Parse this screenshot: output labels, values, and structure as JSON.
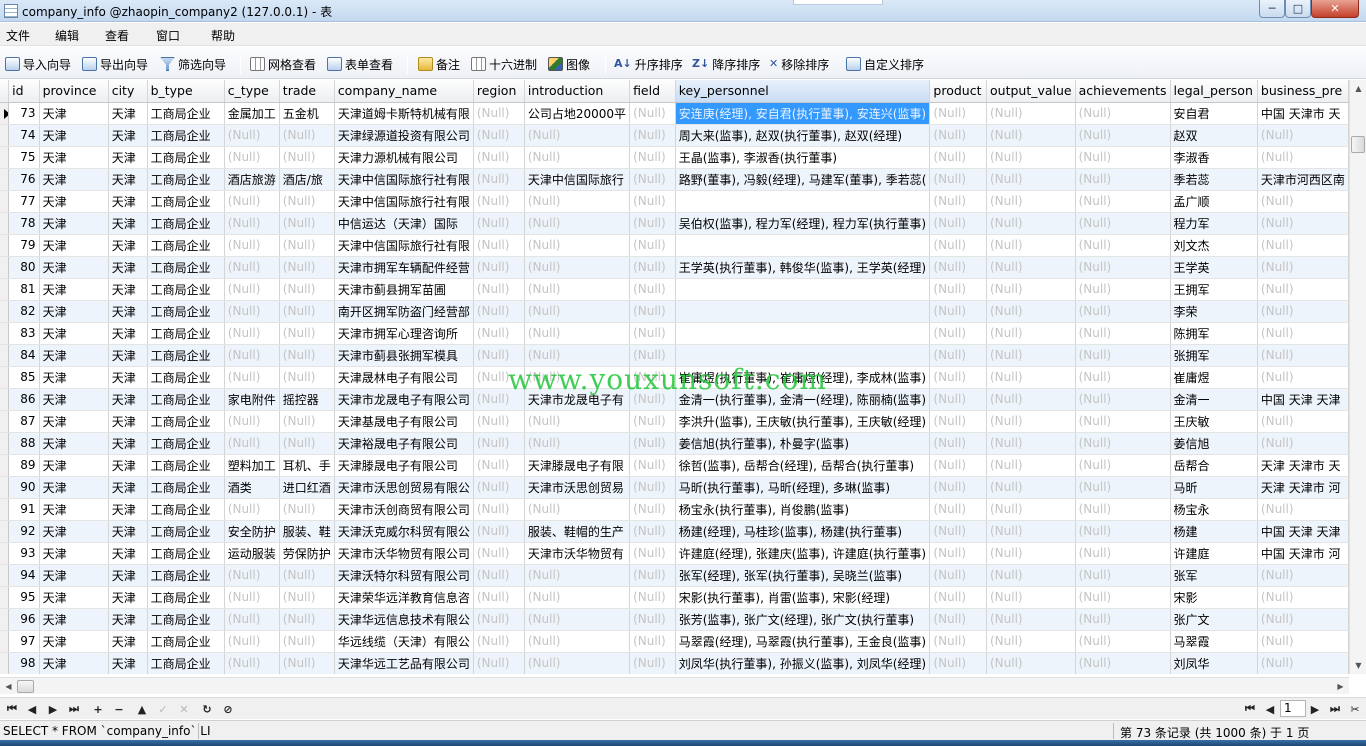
{
  "window": {
    "title": "company_info @zhaopin_company2 (127.0.0.1) - 表",
    "min": "─",
    "max": "□",
    "close": "✕"
  },
  "menu": [
    "文件",
    "编辑",
    "查看",
    "窗口",
    "帮助"
  ],
  "toolbar": {
    "import": "导入向导",
    "export": "导出向导",
    "filter": "筛选向导",
    "grid_view": "网格查看",
    "form_view": "表单查看",
    "memo": "备注",
    "hex": "十六进制",
    "image": "图像",
    "sort_asc": "升序排序",
    "sort_desc": "降序排序",
    "remove_sort": "移除排序",
    "custom_sort": "自定义排序"
  },
  "columns": [
    "id",
    "province",
    "city",
    "b_type",
    "c_type",
    "trade",
    "company_name",
    "region",
    "introduction",
    "field",
    "key_personnel",
    "product",
    "output_value",
    "achievements",
    "legal_person",
    "business_pre"
  ],
  "selected_column": "key_personnel",
  "rows": [
    [
      "73",
      "天津",
      "天津",
      "工商局企业",
      "金属加工",
      "五金机",
      "天津道姆卡斯特机械有限",
      "(Null)",
      "公司占地20000平",
      "(Null)",
      "安连庚(经理), 安自君(执行董事), 安连兴(监事)",
      "(Null)",
      "(Null)",
      "(Null)",
      "安自君",
      "中国 天津市 天"
    ],
    [
      "74",
      "天津",
      "天津",
      "工商局企业",
      "(Null)",
      "(Null)",
      "天津绿源道投资有限公司",
      "(Null)",
      "(Null)",
      "(Null)",
      "周大来(监事), 赵双(执行董事), 赵双(经理)",
      "(Null)",
      "(Null)",
      "(Null)",
      "赵双",
      "(Null)"
    ],
    [
      "75",
      "天津",
      "天津",
      "工商局企业",
      "(Null)",
      "(Null)",
      "天津力源机械有限公司",
      "(Null)",
      "(Null)",
      "(Null)",
      "王晶(监事), 李淑香(执行董事)",
      "(Null)",
      "(Null)",
      "(Null)",
      "李淑香",
      "(Null)"
    ],
    [
      "76",
      "天津",
      "天津",
      "工商局企业",
      "酒店旅游",
      "酒店/旅",
      "天津中信国际旅行社有限",
      "(Null)",
      "天津中信国际旅行",
      "(Null)",
      "路野(董事), 冯毅(经理), 马建军(董事), 季若蕊(",
      "(Null)",
      "(Null)",
      "(Null)",
      "季若蕊",
      "天津市河西区南"
    ],
    [
      "77",
      "天津",
      "天津",
      "工商局企业",
      "(Null)",
      "(Null)",
      "天津中信国际旅行社有限",
      "(Null)",
      "(Null)",
      "(Null)",
      "",
      "(Null)",
      "(Null)",
      "(Null)",
      "孟广顺",
      "(Null)"
    ],
    [
      "78",
      "天津",
      "天津",
      "工商局企业",
      "(Null)",
      "(Null)",
      "中信运达（天津）国际",
      "(Null)",
      "(Null)",
      "(Null)",
      "吴伯权(监事), 程力军(经理), 程力军(执行董事)",
      "(Null)",
      "(Null)",
      "(Null)",
      "程力军",
      "(Null)"
    ],
    [
      "79",
      "天津",
      "天津",
      "工商局企业",
      "(Null)",
      "(Null)",
      "天津中信国际旅行社有限",
      "(Null)",
      "(Null)",
      "(Null)",
      "",
      "(Null)",
      "(Null)",
      "(Null)",
      "刘文杰",
      "(Null)"
    ],
    [
      "80",
      "天津",
      "天津",
      "工商局企业",
      "(Null)",
      "(Null)",
      "天津市拥军车辆配件经营",
      "(Null)",
      "(Null)",
      "(Null)",
      "王学英(执行董事), 韩俊华(监事), 王学英(经理)",
      "(Null)",
      "(Null)",
      "(Null)",
      "王学英",
      "(Null)"
    ],
    [
      "81",
      "天津",
      "天津",
      "工商局企业",
      "(Null)",
      "(Null)",
      "天津市蓟县拥军苗圃",
      "(Null)",
      "(Null)",
      "(Null)",
      "",
      "(Null)",
      "(Null)",
      "(Null)",
      "王拥军",
      "(Null)"
    ],
    [
      "82",
      "天津",
      "天津",
      "工商局企业",
      "(Null)",
      "(Null)",
      "南开区拥军防盗门经营部",
      "(Null)",
      "(Null)",
      "(Null)",
      "",
      "(Null)",
      "(Null)",
      "(Null)",
      "李荣",
      "(Null)"
    ],
    [
      "83",
      "天津",
      "天津",
      "工商局企业",
      "(Null)",
      "(Null)",
      "天津市拥军心理咨询所",
      "(Null)",
      "(Null)",
      "(Null)",
      "",
      "(Null)",
      "(Null)",
      "(Null)",
      "陈拥军",
      "(Null)"
    ],
    [
      "84",
      "天津",
      "天津",
      "工商局企业",
      "(Null)",
      "(Null)",
      "天津市蓟县张拥军模具",
      "(Null)",
      "(Null)",
      "(Null)",
      "",
      "(Null)",
      "(Null)",
      "(Null)",
      "张拥军",
      "(Null)"
    ],
    [
      "85",
      "天津",
      "天津",
      "工商局企业",
      "(Null)",
      "(Null)",
      "天津晟林电子有限公司",
      "(Null)",
      "(Null)",
      "(Null)",
      "崔庸煜(执行董事), 崔庸煜(经理), 李成林(监事)",
      "(Null)",
      "(Null)",
      "(Null)",
      "崔庸煜",
      "(Null)"
    ],
    [
      "86",
      "天津",
      "天津",
      "工商局企业",
      "家电附件",
      "摇控器",
      "天津市龙晟电子有限公司",
      "(Null)",
      "天津市龙晟电子有",
      "(Null)",
      "金清一(执行董事), 金清一(经理), 陈丽楠(监事)",
      "(Null)",
      "(Null)",
      "(Null)",
      "金清一",
      "中国 天津 天津"
    ],
    [
      "87",
      "天津",
      "天津",
      "工商局企业",
      "(Null)",
      "(Null)",
      "天津基晟电子有限公司",
      "(Null)",
      "(Null)",
      "(Null)",
      "李洪升(监事), 王庆敏(执行董事), 王庆敏(经理)",
      "(Null)",
      "(Null)",
      "(Null)",
      "王庆敏",
      "(Null)"
    ],
    [
      "88",
      "天津",
      "天津",
      "工商局企业",
      "(Null)",
      "(Null)",
      "天津裕晟电子有限公司",
      "(Null)",
      "(Null)",
      "(Null)",
      "姜信旭(执行董事), 朴曼字(监事)",
      "(Null)",
      "(Null)",
      "(Null)",
      "姜信旭",
      "(Null)"
    ],
    [
      "89",
      "天津",
      "天津",
      "工商局企业",
      "塑料加工",
      "耳机、手",
      "天津滕晟电子有限公司",
      "(Null)",
      "天津滕晟电子有限",
      "(Null)",
      "徐哲(监事), 岳帮合(经理), 岳帮合(执行董事)",
      "(Null)",
      "(Null)",
      "(Null)",
      "岳帮合",
      "天津 天津市 天"
    ],
    [
      "90",
      "天津",
      "天津",
      "工商局企业",
      "酒类",
      "进口红酒",
      "天津市沃思创贸易有限公",
      "(Null)",
      "天津市沃思创贸易",
      "(Null)",
      "马昕(执行董事), 马昕(经理), 多琳(监事)",
      "(Null)",
      "(Null)",
      "(Null)",
      "马昕",
      "天津 天津市 河"
    ],
    [
      "91",
      "天津",
      "天津",
      "工商局企业",
      "(Null)",
      "(Null)",
      "天津市沃创商贸有限公司",
      "(Null)",
      "(Null)",
      "(Null)",
      "杨宝永(执行董事), 肖俊鹏(监事)",
      "(Null)",
      "(Null)",
      "(Null)",
      "杨宝永",
      "(Null)"
    ],
    [
      "92",
      "天津",
      "天津",
      "工商局企业",
      "安全防护",
      "服装、鞋",
      "天津沃克威尔科贸有限公",
      "(Null)",
      "服装、鞋帽的生产",
      "(Null)",
      "杨建(经理), 马桂珍(监事), 杨建(执行董事)",
      "(Null)",
      "(Null)",
      "(Null)",
      "杨建",
      "中国 天津 天津"
    ],
    [
      "93",
      "天津",
      "天津",
      "工商局企业",
      "运动服装",
      "劳保防护",
      "天津市沃华物贸有限公司",
      "(Null)",
      "天津市沃华物贸有",
      "(Null)",
      "许建庭(经理), 张建庆(监事), 许建庭(执行董事)",
      "(Null)",
      "(Null)",
      "(Null)",
      "许建庭",
      "中国 天津市 河"
    ],
    [
      "94",
      "天津",
      "天津",
      "工商局企业",
      "(Null)",
      "(Null)",
      "天津沃特尔科贸有限公司",
      "(Null)",
      "(Null)",
      "(Null)",
      "张军(经理), 张军(执行董事), 吴晓兰(监事)",
      "(Null)",
      "(Null)",
      "(Null)",
      "张军",
      "(Null)"
    ],
    [
      "95",
      "天津",
      "天津",
      "工商局企业",
      "(Null)",
      "(Null)",
      "天津荣华远洋教育信息咨",
      "(Null)",
      "(Null)",
      "(Null)",
      "宋影(执行董事), 肖雷(监事), 宋影(经理)",
      "(Null)",
      "(Null)",
      "(Null)",
      "宋影",
      "(Null)"
    ],
    [
      "96",
      "天津",
      "天津",
      "工商局企业",
      "(Null)",
      "(Null)",
      "天津华远信息技术有限公",
      "(Null)",
      "(Null)",
      "(Null)",
      "张芳(监事), 张广文(经理), 张广文(执行董事)",
      "(Null)",
      "(Null)",
      "(Null)",
      "张广文",
      "(Null)"
    ],
    [
      "97",
      "天津",
      "天津",
      "工商局企业",
      "(Null)",
      "(Null)",
      "华远线缆（天津）有限公",
      "(Null)",
      "(Null)",
      "(Null)",
      "马翠霞(经理), 马翠霞(执行董事), 王金良(监事)",
      "(Null)",
      "(Null)",
      "(Null)",
      "马翠霞",
      "(Null)"
    ],
    [
      "98",
      "天津",
      "天津",
      "工商局企业",
      "(Null)",
      "(Null)",
      "天津华远工艺品有限公司",
      "(Null)",
      "(Null)",
      "(Null)",
      "刘凤华(执行董事), 孙振义(监事), 刘凤华(经理)",
      "(Null)",
      "(Null)",
      "(Null)",
      "刘凤华",
      "(Null)"
    ]
  ],
  "current_row": "73",
  "navigation": {
    "page": "1"
  },
  "status": {
    "sql": "SELECT * FROM `company_info` LI",
    "record": "第 73 条记录 (共 1000 条) 于 1 页"
  },
  "watermark": "www.youxunsoft.com",
  "colors": {
    "selection": "#3399ff",
    "alt_row": "#eef4fc",
    "null_text": "#c4c4c4"
  }
}
